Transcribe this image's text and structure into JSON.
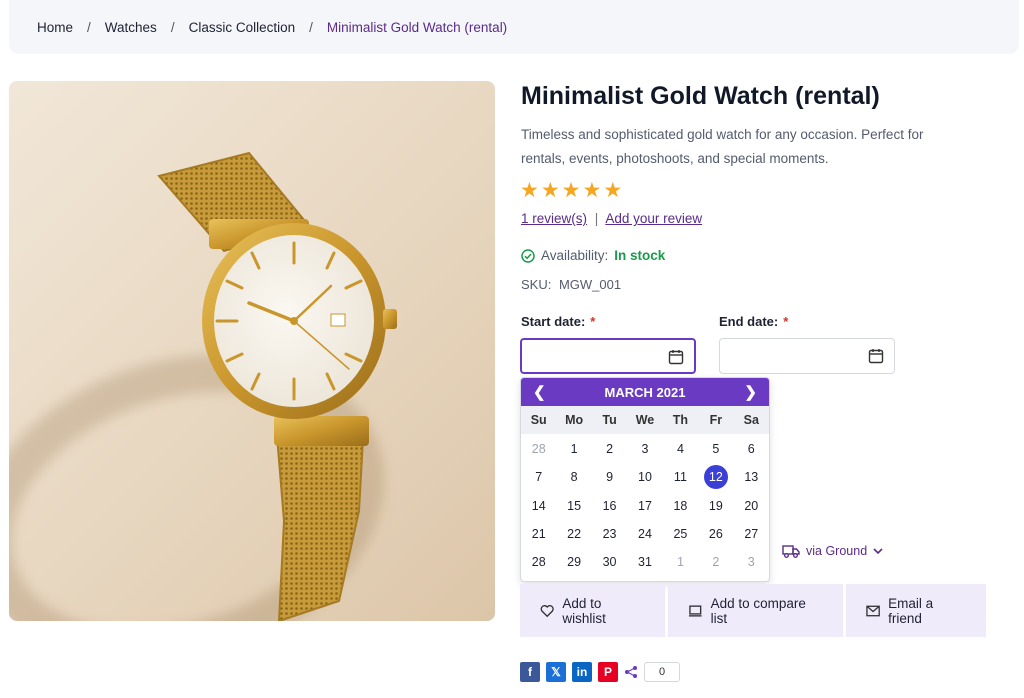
{
  "breadcrumb": {
    "items": [
      "Home",
      "Watches",
      "Classic Collection"
    ],
    "current": "Minimalist Gold Watch (rental)",
    "separator": "/"
  },
  "product": {
    "title": "Minimalist Gold Watch (rental)",
    "description": "Timeless and sophisticated gold watch for any occasion. Perfect for rentals, events, photoshoots, and special moments.",
    "rating": 5,
    "rating_max": 5,
    "reviews_link": "1 review(s)",
    "add_review_link": "Add your review",
    "review_separator": "|",
    "availability_label": "Availability:",
    "availability_value": "In stock",
    "sku_label": "SKU:",
    "sku_value": "MGW_001",
    "image_icon": "gold-wristwatch-image"
  },
  "rental": {
    "start_label": "Start date:",
    "end_label": "End date:",
    "required_mark": "*",
    "start_value": "",
    "end_value": ""
  },
  "calendar": {
    "month_label": "MARCH 2021",
    "weekdays": [
      "Su",
      "Mo",
      "Tu",
      "We",
      "Th",
      "Fr",
      "Sa"
    ],
    "days": [
      {
        "d": "28",
        "muted": true
      },
      {
        "d": "1"
      },
      {
        "d": "2"
      },
      {
        "d": "3"
      },
      {
        "d": "4"
      },
      {
        "d": "5"
      },
      {
        "d": "6"
      },
      {
        "d": "7"
      },
      {
        "d": "8"
      },
      {
        "d": "9"
      },
      {
        "d": "10"
      },
      {
        "d": "11"
      },
      {
        "d": "12",
        "selected": true
      },
      {
        "d": "13"
      },
      {
        "d": "14"
      },
      {
        "d": "15"
      },
      {
        "d": "16"
      },
      {
        "d": "17"
      },
      {
        "d": "18"
      },
      {
        "d": "19"
      },
      {
        "d": "20"
      },
      {
        "d": "21"
      },
      {
        "d": "22"
      },
      {
        "d": "23"
      },
      {
        "d": "24"
      },
      {
        "d": "25"
      },
      {
        "d": "26"
      },
      {
        "d": "27"
      },
      {
        "d": "28"
      },
      {
        "d": "29"
      },
      {
        "d": "30"
      },
      {
        "d": "31"
      },
      {
        "d": "1",
        "muted": true
      },
      {
        "d": "2",
        "muted": true
      },
      {
        "d": "3",
        "muted": true
      }
    ]
  },
  "shipping": {
    "label": "via Ground"
  },
  "actions": {
    "wishlist": "Add to wishlist",
    "compare": "Add to compare list",
    "email": "Email a friend"
  },
  "share": {
    "count": "0",
    "networks": [
      "facebook",
      "x",
      "linkedin",
      "pinterest"
    ]
  },
  "colors": {
    "accent": "#6a3bc2",
    "selected_day": "#3b3fd6",
    "in_stock": "#1a9a4b",
    "star": "#f5a623"
  }
}
